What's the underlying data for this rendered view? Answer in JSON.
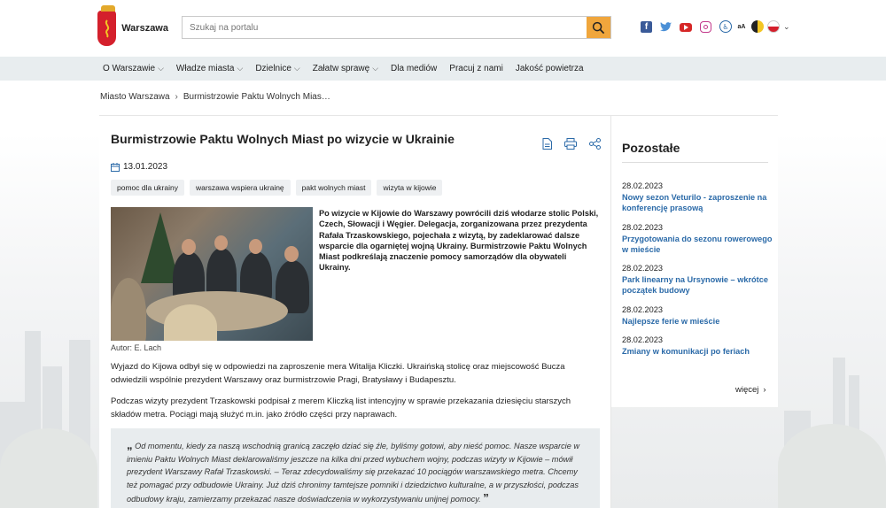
{
  "header": {
    "logo_text": "Warszawa",
    "search_placeholder": "Szukaj na portalu"
  },
  "nav": [
    {
      "label": "O Warszawie",
      "has_dropdown": true
    },
    {
      "label": "Władze miasta",
      "has_dropdown": true
    },
    {
      "label": "Dzielnice",
      "has_dropdown": true
    },
    {
      "label": "Załatw sprawę",
      "has_dropdown": true
    },
    {
      "label": "Dla mediów",
      "has_dropdown": false
    },
    {
      "label": "Pracuj z nami",
      "has_dropdown": false
    },
    {
      "label": "Jakość powietrza",
      "has_dropdown": false
    }
  ],
  "breadcrumb": {
    "home": "Miasto Warszawa",
    "current": "Burmistrzowie Paktu Wolnych Mias…"
  },
  "article": {
    "title": "Burmistrzowie Paktu Wolnych Miast po wizycie w Ukrainie",
    "date": "13.01.2023",
    "tags": [
      "pomoc dla ukrainy",
      "warszawa wspiera ukrainę",
      "pakt wolnych miast",
      "wizyta w kijowie"
    ],
    "photo_author": "Autor: E. Lach",
    "lead": "Po wizycie w Kijowie do Warszawy powrócili dziś włodarze stolic Polski, Czech, Słowacji i Węgier. Delegacja, zorganizowana przez prezydenta Rafała Trzaskowskiego, pojechała z wizytą, by zadeklarować dalsze wsparcie dla ogarniętej wojną Ukrainy. Burmistrzowie Paktu Wolnych Miast podkreślają znaczenie pomocy samorządów dla obywateli Ukrainy.",
    "paragraph_1": "Wyjazd do Kijowa odbył się w odpowiedzi na zaproszenie mera Witalija Kliczki. Ukraińską stolicę oraz miejscowość Bucza odwiedzili wspólnie prezydent Warszawy oraz burmistrzowie Pragi, Bratysławy i Budapesztu.",
    "paragraph_2": "Podczas wizyty prezydent Trzaskowski podpisał z merem Kliczką list intencyjny w sprawie przekazania dziesięciu starszych składów metra. Pociągi mają służyć m.in. jako źródło części przy naprawach.",
    "quote": "Od momentu, kiedy za naszą wschodnią granicą zaczęło dziać się źle, byliśmy gotowi, aby nieść pomoc. Nasze wsparcie w imieniu Paktu Wolnych Miast deklarowaliśmy jeszcze na kilka dni przed wybuchem wojny, podczas wizyty w Kijowie – mówił prezydent Warszawy Rafał Trzaskowski. – Teraz zdecydowaliśmy się przekazać 10 pociągów warszawskiego metra. Chcemy też pomagać przy odbudowie Ukrainy. Już dziś chronimy tamtejsze pomniki i dziedzictwo kulturalne, a w przyszłości, podczas odbudowy kraju, zamierzamy przekazać nasze doświadczenia w wykorzystywaniu unijnej pomocy."
  },
  "sidebar": {
    "heading": "Pozostałe",
    "items": [
      {
        "date": "28.02.2023",
        "title": "Nowy sezon Veturilo - zaproszenie na konferencję prasową"
      },
      {
        "date": "28.02.2023",
        "title": "Przygotowania do sezonu rowerowego w mieście"
      },
      {
        "date": "28.02.2023",
        "title": "Park linearny na Ursynowie – wkrótce początek budowy"
      },
      {
        "date": "28.02.2023",
        "title": "Najlepsze ferie w mieście"
      },
      {
        "date": "28.02.2023",
        "title": "Zmiany w komunikacji po feriach"
      }
    ],
    "more": "więcej"
  },
  "colors": {
    "accent": "#f0a63c",
    "link": "#2b6aa8",
    "nav_bg": "#e8edef",
    "brand_red": "#d4202c"
  }
}
